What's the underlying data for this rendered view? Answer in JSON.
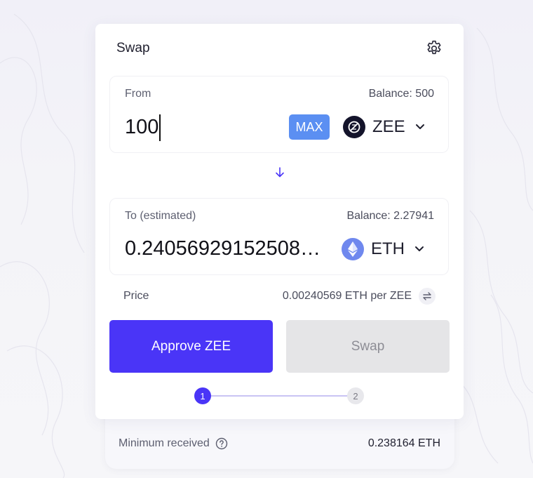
{
  "swap": {
    "title": "Swap",
    "settings_icon": "gear-icon"
  },
  "from": {
    "label": "From",
    "balance": "Balance: 500",
    "amount": "100",
    "max_label": "MAX",
    "token": "ZEE",
    "token_icon": "zee-token-icon"
  },
  "switch_icon": "arrow-down-icon",
  "to": {
    "label": "To (estimated)",
    "balance": "Balance: 2.27941",
    "amount": "0.24056929152508…",
    "token": "ETH",
    "token_icon": "eth-token-icon"
  },
  "price": {
    "label": "Price",
    "value": "0.00240569 ETH per ZEE"
  },
  "buttons": {
    "approve": "Approve ZEE",
    "swap": "Swap"
  },
  "steps": [
    "1",
    "2"
  ],
  "summary": {
    "min_received_label": "Minimum received",
    "min_received_value": "0.238164 ETH"
  },
  "colors": {
    "accent": "#4a35f7",
    "max_button": "#5b8ff2",
    "disabled_button": "#e5e5e7",
    "eth_token": "#6f88ee",
    "zee_token": "#14142b"
  }
}
